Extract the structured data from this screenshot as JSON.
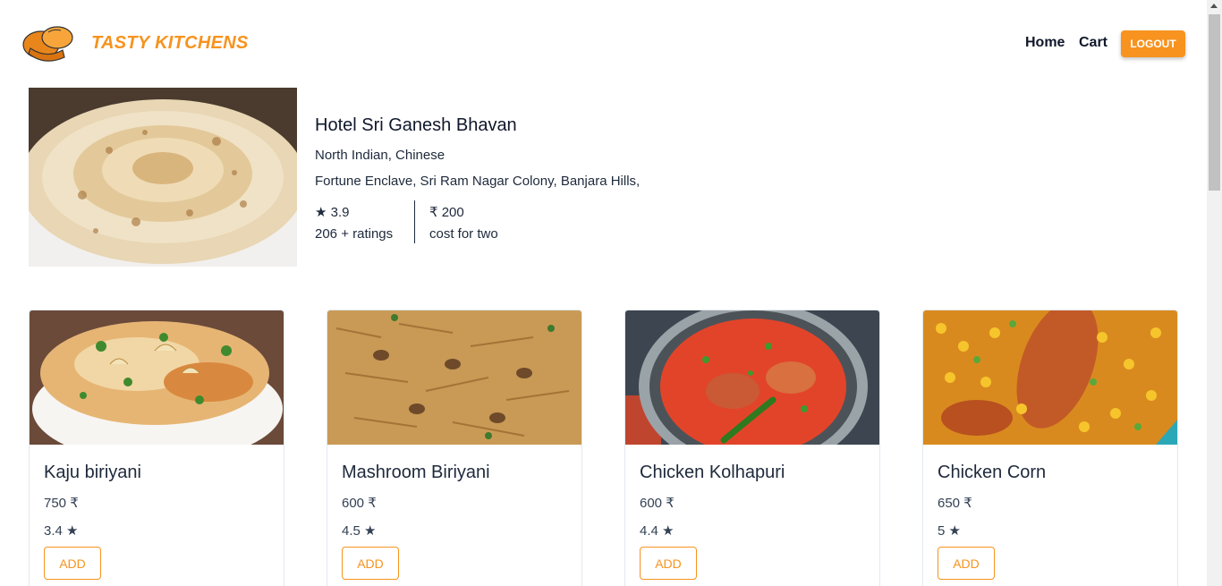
{
  "header": {
    "brand": "TASTY KITCHENS",
    "logo_icon": "chef-hat-icon",
    "nav": {
      "home": "Home",
      "cart": "Cart"
    },
    "logout_label": "LOGOUT",
    "brand_color": "#f7931e"
  },
  "restaurant": {
    "name": "Hotel Sri Ganesh Bhavan",
    "cuisine": "North Indian, Chinese",
    "location": "Fortune Enclave, Sri Ram Nagar Colony, Banjara Hills,",
    "rating": "★ 3.9",
    "ratings_count": "206 + ratings",
    "cost": "₹ 200",
    "cost_label": "cost for two"
  },
  "food_items": [
    {
      "name": "Kaju biriyani",
      "price": "750 ₹",
      "rating": "3.4 ★",
      "add_label": "ADD"
    },
    {
      "name": "Mashroom Biriyani",
      "price": "600 ₹",
      "rating": "4.5 ★",
      "add_label": "ADD"
    },
    {
      "name": "Chicken Kolhapuri",
      "price": "600 ₹",
      "rating": "4.4 ★",
      "add_label": "ADD"
    },
    {
      "name": "Chicken Corn",
      "price": "650 ₹",
      "rating": "5 ★",
      "add_label": "ADD"
    }
  ]
}
